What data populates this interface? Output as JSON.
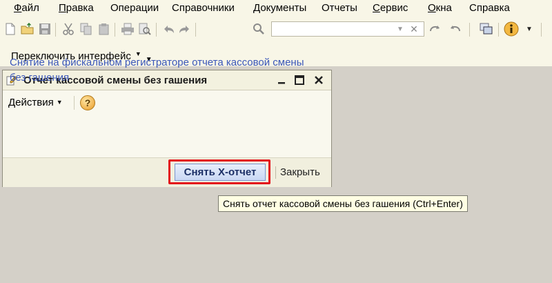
{
  "menu": {
    "items": [
      {
        "acc": "Ф",
        "rest": "айл"
      },
      {
        "acc": "П",
        "rest": "равка"
      },
      {
        "acc": "",
        "rest": "Операции"
      },
      {
        "acc": "",
        "rest": "Справочники"
      },
      {
        "acc": "",
        "rest": "Документы"
      },
      {
        "acc": "",
        "rest": "Отчеты"
      },
      {
        "acc": "С",
        "rest": "ервис"
      },
      {
        "acc": "О",
        "rest": "кна"
      },
      {
        "acc": "",
        "rest": "Справка"
      }
    ]
  },
  "toolbar": {
    "icons": [
      "new-document-icon",
      "open-folder-icon",
      "save-icon",
      "cut-icon",
      "copy-icon",
      "paste-icon",
      "print-icon",
      "print-preview-icon",
      "undo-icon",
      "redo-icon",
      "search-icon",
      "search-next-icon",
      "search-prev-icon",
      "windows-icon",
      "info-icon"
    ],
    "search": {
      "value": "",
      "placeholder": ""
    }
  },
  "switch_interface": {
    "label": "Переключить интерфейс"
  },
  "window": {
    "title": "Отчет кассовой смены без гашения",
    "actions_label": "Действия",
    "help_symbol": "?",
    "body_text": "Снятие  на фискальном регистраторе отчета кассовой смены без гашения",
    "primary_button": "Снять Х-отчет",
    "close_button": "Закрыть",
    "tooltip": "Снять отчет кассовой смены без гашения (Ctrl+Enter)"
  },
  "colors": {
    "accent_highlight": "#e3121b",
    "body_text": "#3b57b9",
    "workspace": "#d4d0c8"
  }
}
